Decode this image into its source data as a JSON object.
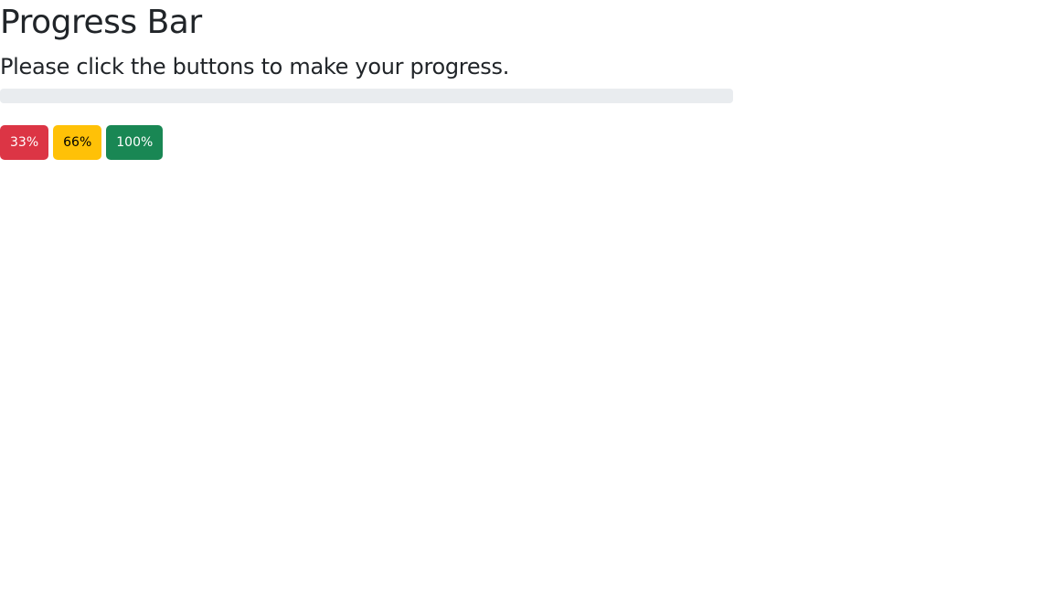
{
  "title": "Progress Bar",
  "subtitle": "Please click the buttons to make your progress.",
  "progress": {
    "value_percent": 0,
    "fill_color": "#0d6efd"
  },
  "buttons": [
    {
      "label": "33%",
      "bg": "#dc3545",
      "fg": "#ffffff"
    },
    {
      "label": "66%",
      "bg": "#ffc107",
      "fg": "#000000"
    },
    {
      "label": "100%",
      "bg": "#198754",
      "fg": "#ffffff"
    }
  ]
}
